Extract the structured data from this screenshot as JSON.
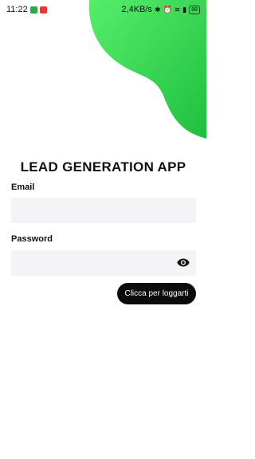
{
  "status_bar": {
    "time": "11:22",
    "network_speed": "2,4KB/s",
    "battery": "88",
    "signal_label": "5G",
    "icons": [
      "notification-green-icon",
      "youtube-icon",
      "bluetooth-icon",
      "alarm-icon",
      "wifi-icon",
      "signal-icon",
      "battery-icon"
    ]
  },
  "app": {
    "title": "LEAD GENERATION APP",
    "accent_color": "#3ddc5a"
  },
  "form": {
    "email_label": "Email",
    "email_value": "",
    "password_label": "Password",
    "password_value": "",
    "login_button": "Clicca per loggarti"
  }
}
